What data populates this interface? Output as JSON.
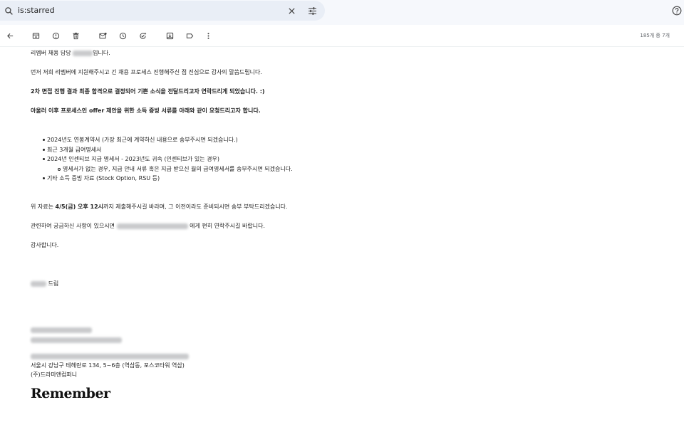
{
  "search": {
    "value": "is:starred"
  },
  "toolbar": {
    "count": "185개 중 7개"
  },
  "email": {
    "line1_prefix": "리멤버 채용 담당",
    "line1_suffix": "입니다.",
    "line2": "먼저 저희 리멤버에 지원해주시고 긴 채용 프로세스 진행해주신 점 진심으로 감사의 말씀드립니다.",
    "line3_a": "2차 면접 진행 결과 ",
    "line3_b": "최종 합격",
    "line3_c": "으로 결정되어 기쁜 소식을 전달드리고자 연락드리게 되었습니다. :)",
    "line4": "아울러 이후 프로세스인 offer 제안을 위한 소득 증빙 서류를 아래와 같이 요청드리고자 합니다.",
    "bullets": [
      "2024년도 연봉계약서 (가장 최근에 계약하신 내용으로 송부주시면 되겠습니다.)",
      "최근 3개월 급여명세서",
      "2024년 인센티브 지급 명세서 - 2023년도 귀속 (인센티브가 있는 경우)"
    ],
    "sub_bullet": "명세서가 없는 경우, 지급 안내 서류 혹은 지급 받으신 월의 급여명세서를 송부주시면 되겠습니다.",
    "bullet4": "기타 소득 증빙 자료 (Stock Option, RSU 등)",
    "deadline_a": "위 자료는 ",
    "deadline_b": "4/5(금) 오후 12시",
    "deadline_c": "까지 제출해주시길 바라며, 그 이전이라도 준비되시면 송부 부탁드리겠습니다.",
    "contact_a": "관련하여 궁금하신 사항이 있으시면",
    "contact_b": "에게 편히 연락주시길 바랍니다.",
    "thanks": "감사합니다.",
    "sign_suffix": "드림",
    "address": "서울시 강남구 테헤란로 134, 5~6층 (역삼동, 포스코타워 역삼)",
    "company": "(주)드라마앤컴퍼니",
    "logo": "Remember"
  }
}
